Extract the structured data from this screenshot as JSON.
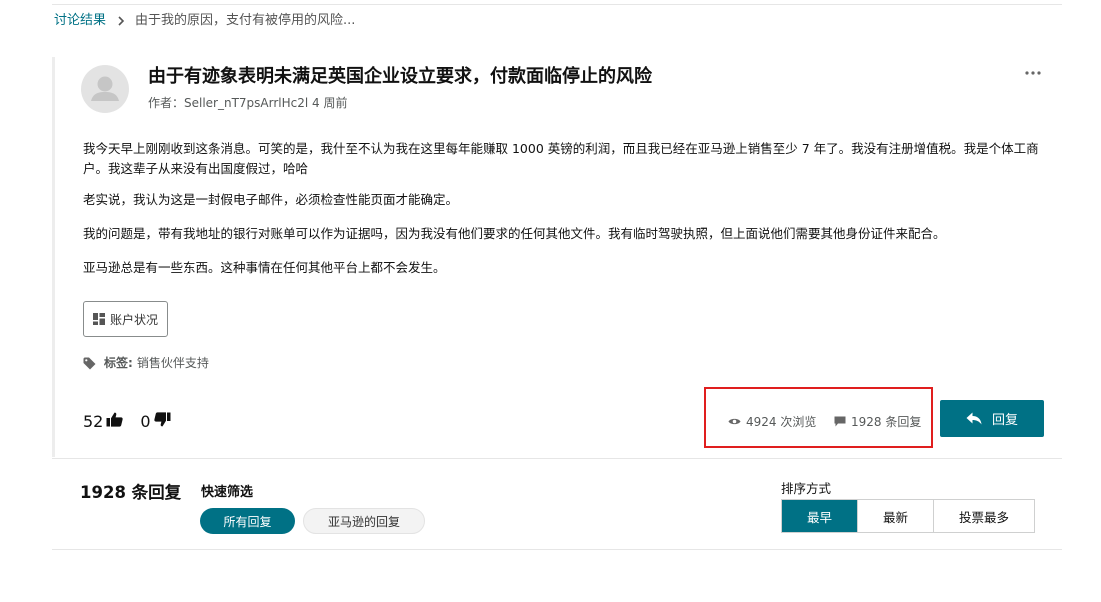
{
  "breadcrumb": {
    "root": "讨论结果",
    "current": "由于我的原因，支付有被停用的风险..."
  },
  "post": {
    "title": "由于有迹象表明未满足英国企业设立要求，付款面临停止的风险",
    "meta": "作者：Seller_nT7psArrlHc2l 4 周前",
    "paragraphs": [
      "我今天早上刚刚收到这条消息。可笑的是，我什至不认为我在这里每年能赚取 1000 英镑的利润，而且我已经在亚马逊上销售至少 7 年了。我没有注册增值税。我是个体工商户。我这辈子从来没有出国度假过，哈哈",
      "老实说，我认为这是一封假电子邮件，必须检查性能页面才能确定。",
      "我的问题是，带有我地址的银行对账单可以作为证据吗，因为我没有他们要求的任何其他文件。我有临时驾驶执照，但上面说他们需要其他身份证件来配合。",
      "亚马逊总是有一些东西。这种事情在任何其他平台上都不会发生。"
    ],
    "account_button": "账户状况",
    "tags_label": "标签:",
    "tag": "销售伙伴支持",
    "upvotes": "52",
    "downvotes": "0",
    "views": "4924 次浏览",
    "reply_count": "1928 条回复",
    "reply_button": "回复"
  },
  "replies": {
    "count": "1928 条回复",
    "filter_label": "快速筛选",
    "filters": [
      "所有回复",
      "亚马逊的回复"
    ],
    "sort_label": "排序方式",
    "sort_options": [
      "最早",
      "最新",
      "投票最多"
    ]
  },
  "colors": {
    "accent": "#007185",
    "highlight": "#e01e1e"
  }
}
